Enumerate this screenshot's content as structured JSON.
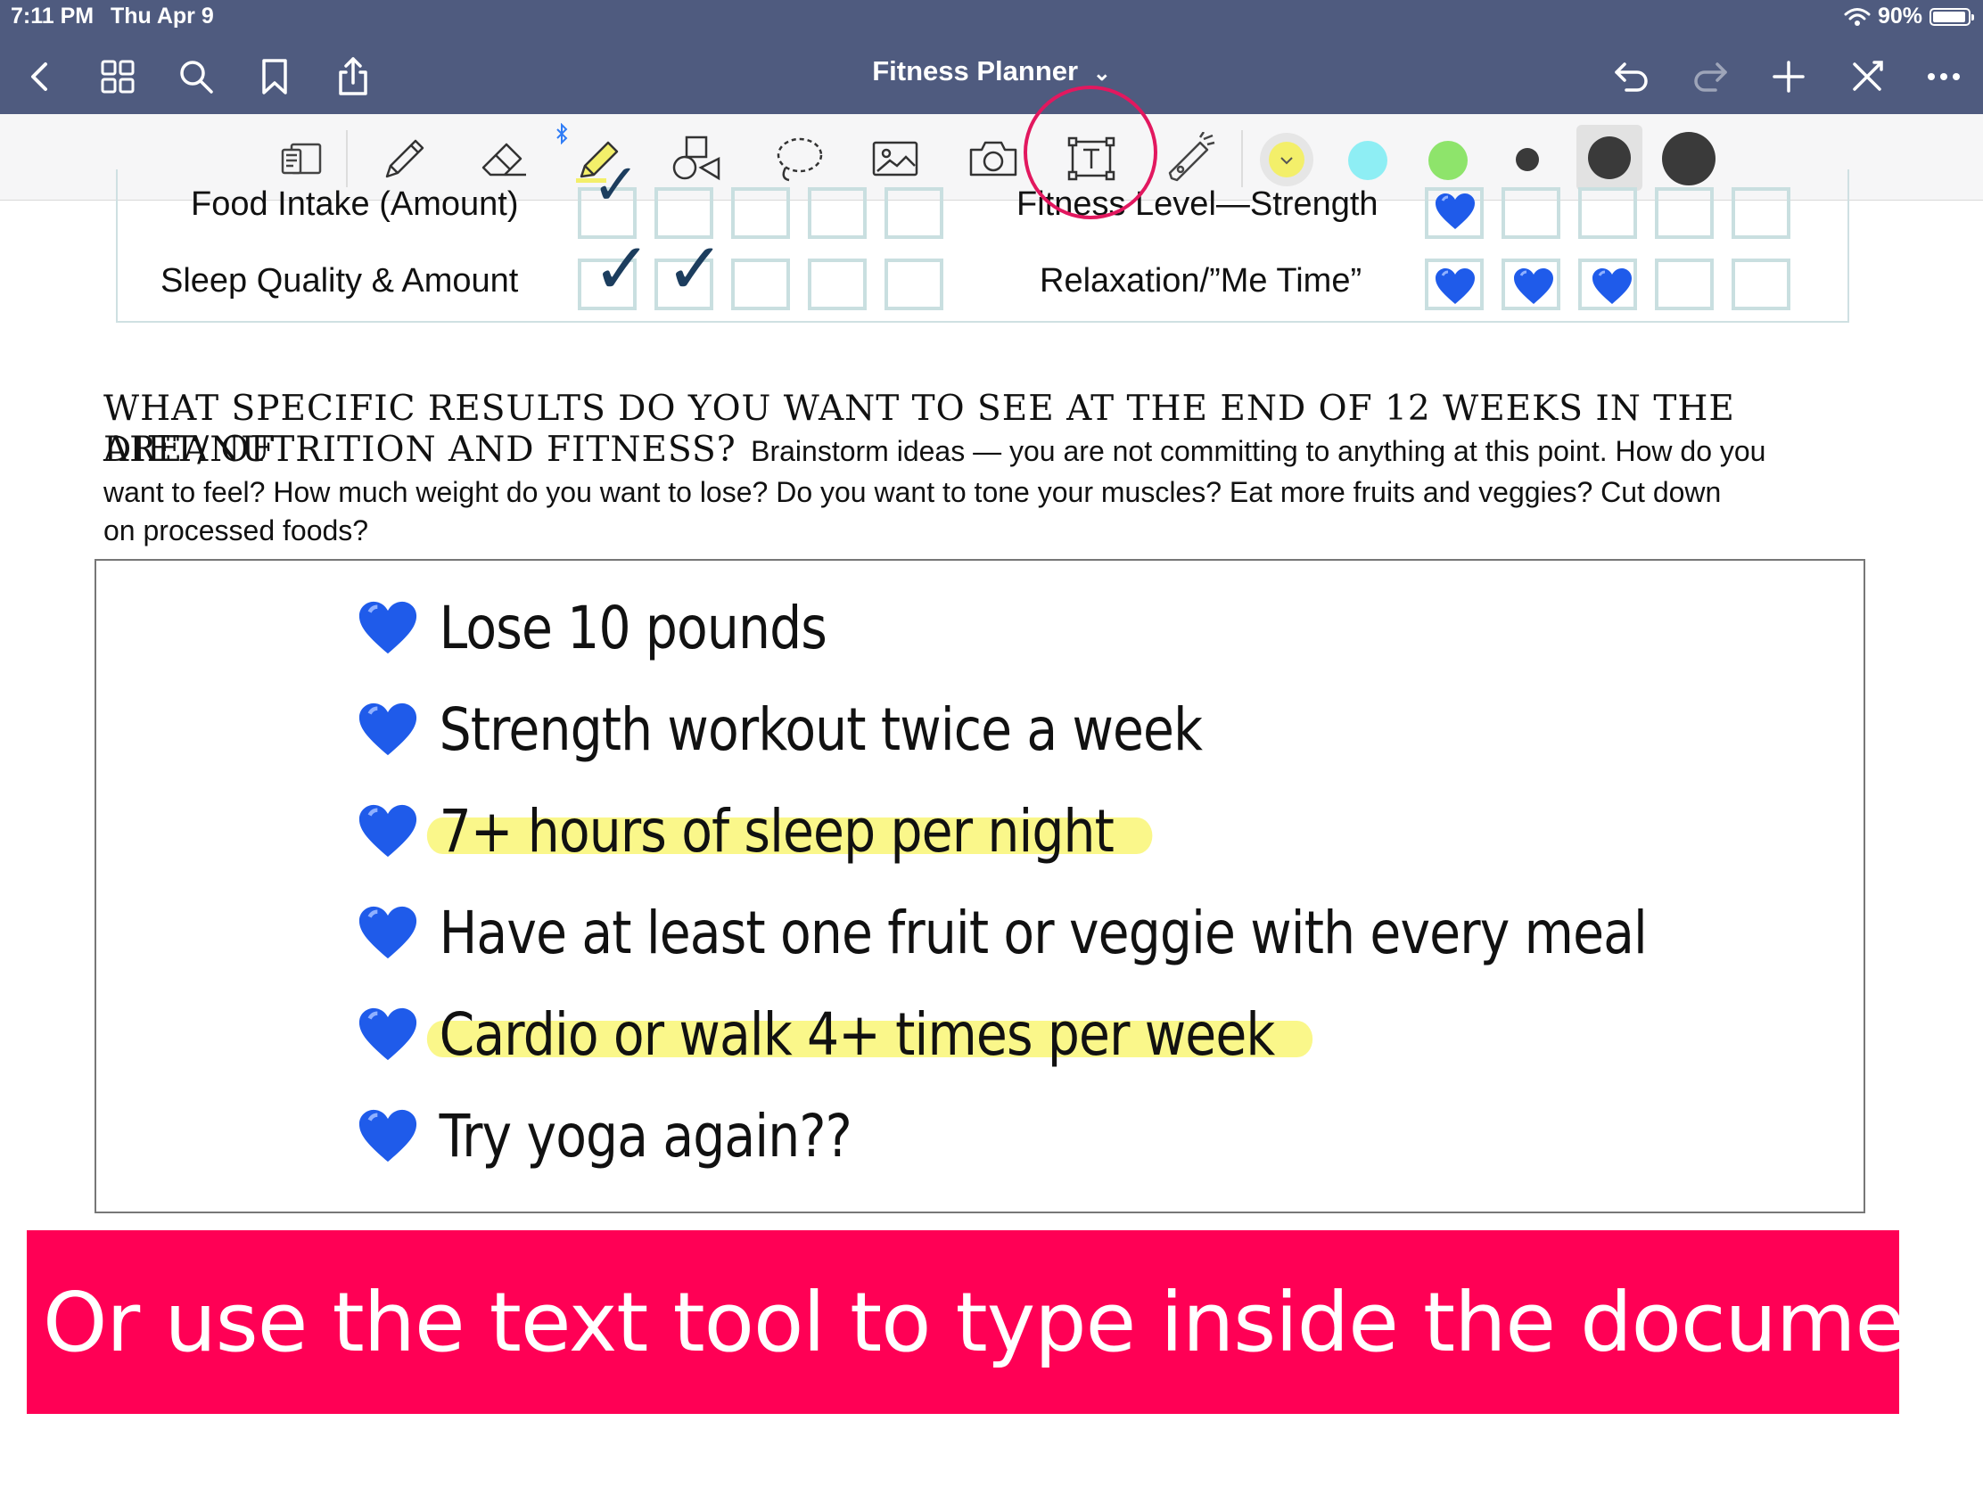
{
  "status_bar": {
    "time": "7:11 PM",
    "date": "Thu Apr 9",
    "battery": "90%",
    "battery_level": 0.9
  },
  "nav": {
    "title": "Fitness Planner",
    "title_chevron": "⌄"
  },
  "toolbar": {
    "tools": [
      "page-view-icon",
      "pen-icon",
      "eraser-icon",
      "highlighter-icon",
      "shapes-icon",
      "lasso-icon",
      "image-icon",
      "camera-icon",
      "text-tool-icon",
      "laser-pointer-icon"
    ],
    "selected_tool": "text-tool-icon",
    "colors": {
      "highlight_yellow": "#f3ef6a",
      "cyan": "#8eeef4",
      "green": "#8ee46b",
      "dot_small": "#3a3a3a",
      "dot_medium": "#3a3a3a",
      "dot_large": "#3a3a3a"
    }
  },
  "tracker": {
    "rows_left": [
      {
        "label": "Food Intake (Amount)",
        "checks": 1
      },
      {
        "label": "Sleep Quality & Amount",
        "checks": 2
      }
    ],
    "rows_right": [
      {
        "label": "Fitness Level—Strength",
        "hearts": 1
      },
      {
        "label": "Relaxation/”Me Time”",
        "hearts": 3
      }
    ],
    "check_glyph": "✓"
  },
  "question": {
    "heading": "WHAT SPECIFIC RESULTS DO YOU WANT TO SEE AT THE END OF 12 WEEKS IN THE AREA OF DIET/NUTRITION AND FITNESS?",
    "heading_line1": "WHAT SPECIFIC RESULTS DO YOU WANT TO SEE AT THE END OF 12 WEEKS IN THE AREA OF",
    "heading_line2": "DIET/NUTRITION AND FITNESS?",
    "body_line1": "Brainstorm ideas — you are not committing to anything at this point. How do you",
    "body_line2": "want to feel? How much weight do  you want to lose? Do you want to tone  your muscles? Eat more fruits and veggies? Cut down",
    "body_line3": "on processed foods?"
  },
  "goals": [
    {
      "text": "Lose 10 pounds",
      "highlighted": false
    },
    {
      "text": "Strength workout twice a week",
      "highlighted": false
    },
    {
      "text": "7+ hours of sleep per night",
      "highlighted": true
    },
    {
      "text": "Have at least one fruit or veggie with every meal",
      "highlighted": false
    },
    {
      "text": "Cardio or walk 4+ times per week",
      "highlighted": true
    },
    {
      "text": "Try yoga again??",
      "highlighted": false
    }
  ],
  "banner": {
    "text": "Or use the text tool to type inside the document.",
    "color": "#ff0055"
  },
  "heart_color": "#1f5bea"
}
